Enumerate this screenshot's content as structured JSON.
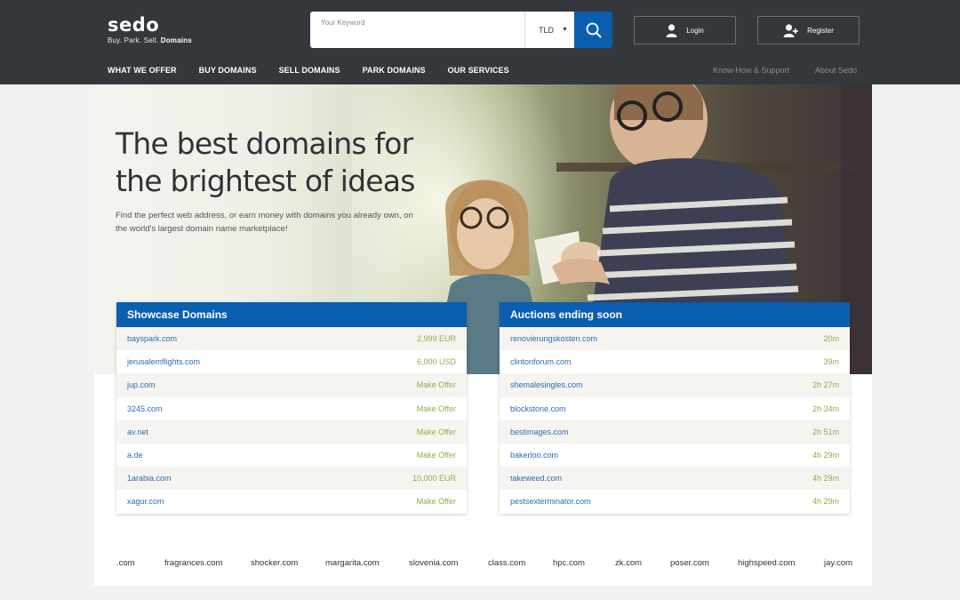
{
  "brand": {
    "name": "sedo",
    "tagline": "Buy. Park. Sell.",
    "tagline_bold": "Domains"
  },
  "search": {
    "label": "Your Keyword",
    "value": "",
    "tld": "TLD"
  },
  "auth": {
    "login": "Login",
    "register": "Register"
  },
  "nav": {
    "items": [
      "WHAT WE OFFER",
      "BUY DOMAINS",
      "SELL DOMAINS",
      "PARK DOMAINS",
      "OUR SERVICES"
    ],
    "right": [
      "Know-How & Support",
      "About Sedo"
    ]
  },
  "hero": {
    "title_line1": "The best domains for",
    "title_line2": "the brightest of ideas",
    "subtitle": "Find the perfect web address, or earn money with domains you already own, on the world's largest domain name marketplace!"
  },
  "showcase": {
    "title": "Showcase Domains",
    "rows": [
      {
        "name": "bayspark.com",
        "value": "2,999 EUR"
      },
      {
        "name": "jerusalemflights.com",
        "value": "6,000 USD"
      },
      {
        "name": "jup.com",
        "value": "Make Offer"
      },
      {
        "name": "3245.com",
        "value": "Make Offer"
      },
      {
        "name": "av.net",
        "value": "Make Offer"
      },
      {
        "name": "a.de",
        "value": "Make Offer"
      },
      {
        "name": "1arabia.com",
        "value": "10,000 EUR"
      },
      {
        "name": "xagur.com",
        "value": "Make Offer"
      }
    ]
  },
  "auctions": {
    "title": "Auctions ending soon",
    "rows": [
      {
        "name": "renovierungskosten.com",
        "value": "20m"
      },
      {
        "name": "clintonforum.com",
        "value": "39m"
      },
      {
        "name": "shemalesingles.com",
        "value": "2h 27m"
      },
      {
        "name": "blockstone.com",
        "value": "2h 34m"
      },
      {
        "name": "bestimages.com",
        "value": "2h 51m"
      },
      {
        "name": "bakerloo.com",
        "value": "4h 29m"
      },
      {
        "name": "takeweed.com",
        "value": "4h 29m"
      },
      {
        "name": "pestsexterminator.com",
        "value": "4h 29m"
      }
    ]
  },
  "ticker": [
    ".com",
    "fragrances.com",
    "shocker.com",
    "margarita.com",
    "slovenia.com",
    "class.com",
    "hpc.com",
    "zk.com",
    "poser.com",
    "highspeed.com",
    "jay.com"
  ],
  "colors": {
    "header": "#34383d",
    "accent": "#0a5eaf",
    "link": "#2a6db3",
    "price": "#8bb04c"
  },
  "icons": {
    "search": "search-icon",
    "login": "user-icon",
    "register": "user-plus-icon",
    "tld": "chevron-down-icon"
  }
}
